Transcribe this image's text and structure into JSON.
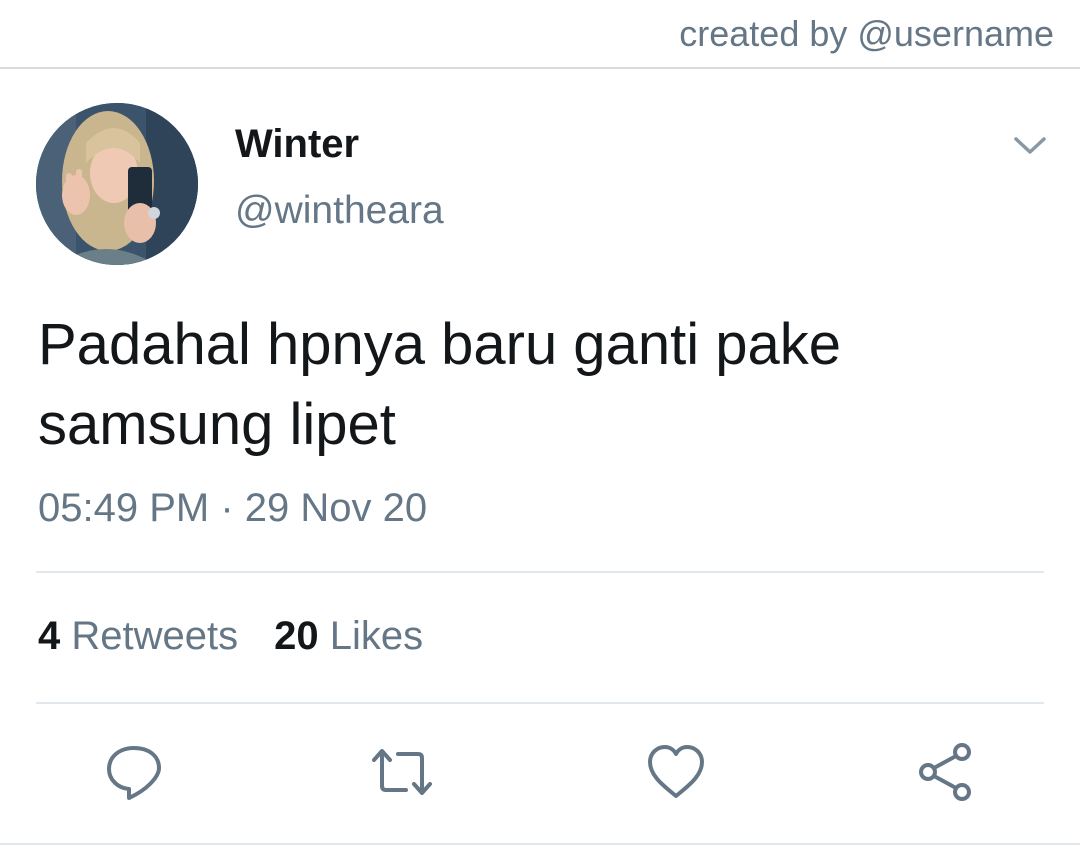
{
  "credit": "created by @username",
  "user": {
    "name": "Winter",
    "handle": "@wintheara"
  },
  "tweet": {
    "text_line1": "Padahal hpnya baru ganti pake",
    "text_line2": "samsung lipet",
    "timestamp": "05:49 PM · 29 Nov 20"
  },
  "stats": {
    "retweets_count": "4",
    "retweets_label": "Retweets",
    "likes_count": "20",
    "likes_label": "Likes"
  },
  "icons": {
    "reply": "reply-icon",
    "retweet": "retweet-icon",
    "like": "heart-icon",
    "share": "share-icon",
    "menu": "chevron-down-icon"
  },
  "colors": {
    "primary_text": "#14171a",
    "secondary_text": "#657786",
    "divider": "#e1e8ed"
  }
}
